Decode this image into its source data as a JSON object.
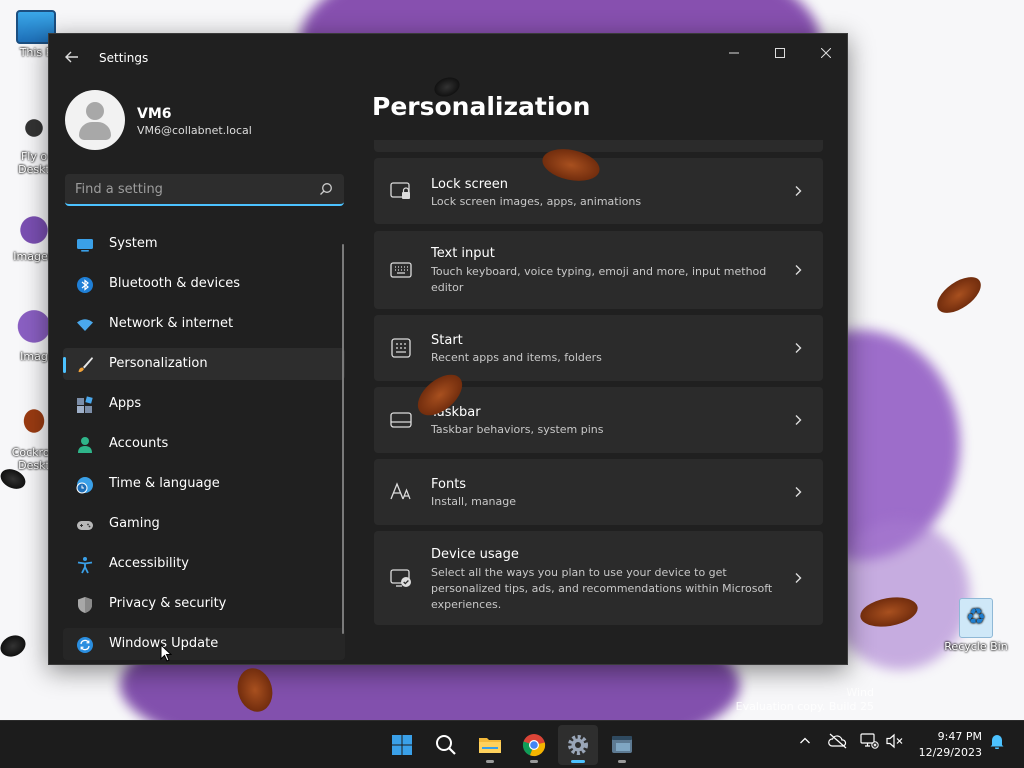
{
  "window": {
    "app_title": "Settings",
    "controls": {
      "minimize": "—",
      "maximize": "☐",
      "close": "✕"
    }
  },
  "profile": {
    "name": "VM6",
    "email": "VM6@collabnet.local"
  },
  "search": {
    "placeholder": "Find a setting",
    "value": ""
  },
  "nav": {
    "items": [
      {
        "label": "System",
        "icon": "system-icon",
        "active": false
      },
      {
        "label": "Bluetooth & devices",
        "icon": "bluetooth-icon",
        "active": false
      },
      {
        "label": "Network & internet",
        "icon": "wifi-icon",
        "active": false
      },
      {
        "label": "Personalization",
        "icon": "brush-icon",
        "active": true
      },
      {
        "label": "Apps",
        "icon": "apps-icon",
        "active": false
      },
      {
        "label": "Accounts",
        "icon": "accounts-icon",
        "active": false
      },
      {
        "label": "Time & language",
        "icon": "globe-clock-icon",
        "active": false
      },
      {
        "label": "Gaming",
        "icon": "gamepad-icon",
        "active": false
      },
      {
        "label": "Accessibility",
        "icon": "accessibility-icon",
        "active": false
      },
      {
        "label": "Privacy & security",
        "icon": "shield-icon",
        "active": false
      },
      {
        "label": "Windows Update",
        "icon": "update-icon",
        "active": false
      }
    ]
  },
  "main": {
    "title": "Personalization",
    "cards": [
      {
        "title": "Lock screen",
        "desc": "Lock screen images, apps, animations",
        "icon": "lock-screen-icon"
      },
      {
        "title": "Text input",
        "desc": "Touch keyboard, voice typing, emoji and more, input method editor",
        "icon": "keyboard-icon"
      },
      {
        "title": "Start",
        "desc": "Recent apps and items, folders",
        "icon": "start-menu-icon"
      },
      {
        "title": "Taskbar",
        "desc": "Taskbar behaviors, system pins",
        "icon": "taskbar-icon"
      },
      {
        "title": "Fonts",
        "desc": "Install, manage",
        "icon": "fonts-icon"
      },
      {
        "title": "Device usage",
        "desc": "Select all the ways you plan to use your device to get personalized tips, ads, and recommendations within Microsoft experiences.",
        "icon": "device-usage-icon"
      }
    ]
  },
  "desktop": {
    "icons": [
      {
        "label": "This P",
        "icon": "this-pc-icon"
      },
      {
        "label": "Fly o\nDeskt",
        "icon": "fly-shortcut-icon"
      },
      {
        "label": "Imagen",
        "icon": "image-icon"
      },
      {
        "label": "Imag",
        "icon": "image-icon"
      },
      {
        "label": "Cockroa\nDeskt",
        "icon": "cockroach-shortcut-icon"
      },
      {
        "label": "Recycle Bin",
        "icon": "recycle-bin-icon"
      }
    ],
    "watermark_line1": "Wind",
    "watermark_line2": "Evaluation copy. Build 25"
  },
  "taskbar": {
    "apps": [
      "start-icon",
      "search-icon",
      "file-explorer-icon",
      "chrome-icon",
      "settings-icon",
      "terminal-icon"
    ],
    "active_app": "settings-icon",
    "tray": {
      "chevron": "^"
    },
    "time": "9:47 PM",
    "date": "12/29/2023"
  },
  "colors": {
    "accent": "#4cc2ff",
    "window_bg": "#202020",
    "card_bg": "#2b2b2b",
    "taskbar_bg": "#1c1c1c"
  }
}
